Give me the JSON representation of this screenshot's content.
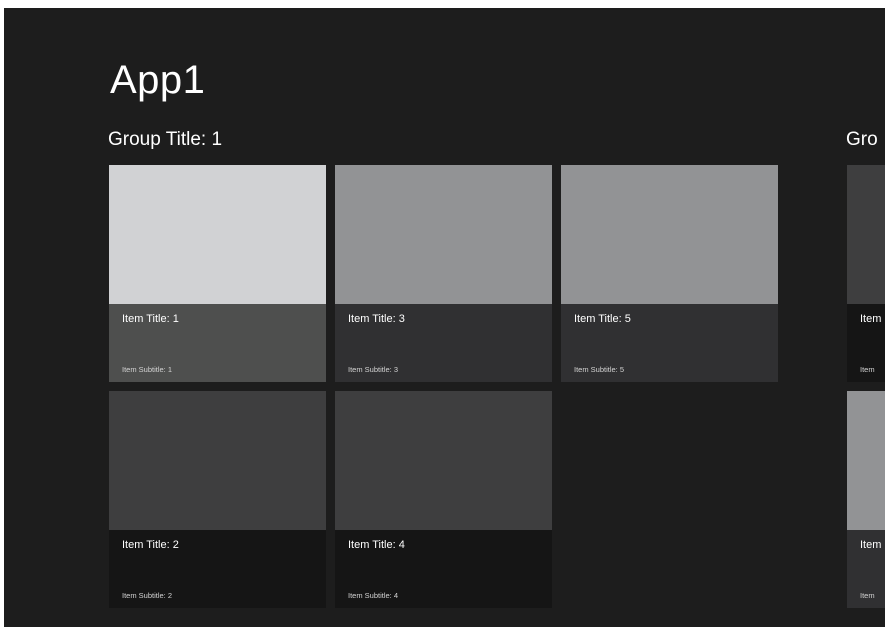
{
  "app": {
    "title": "App1"
  },
  "groups": [
    {
      "title": "Group Title: 1",
      "items": [
        {
          "title": "Item Title: 1",
          "subtitle": "Item Subtitle: 1",
          "image_color": "#d1d2d4",
          "caption_color": "#4e4f4e"
        },
        {
          "title": "Item Title: 2",
          "subtitle": "Item Subtitle: 2",
          "image_color": "#3e3e3f",
          "caption_color": "#151515"
        },
        {
          "title": "Item Title: 3",
          "subtitle": "Item Subtitle: 3",
          "image_color": "#929395",
          "caption_color": "#303032"
        },
        {
          "title": "Item Title: 4",
          "subtitle": "Item Subtitle: 4",
          "image_color": "#3e3e3f",
          "caption_color": "#151515"
        },
        {
          "title": "Item Title: 5",
          "subtitle": "Item Subtitle: 5",
          "image_color": "#929395",
          "caption_color": "#303032"
        }
      ]
    },
    {
      "title": "Gro",
      "items": [
        {
          "title": "Item",
          "subtitle": "Item",
          "image_color": "#3e3e3f",
          "caption_color": "#151515"
        },
        {
          "title": "Item",
          "subtitle": "Item",
          "image_color": "#929395",
          "caption_color": "#303032"
        }
      ]
    }
  ],
  "colors": {
    "background": "#1d1d1d",
    "text": "#ffffff",
    "subtitle_text": "#d4d4d4"
  }
}
